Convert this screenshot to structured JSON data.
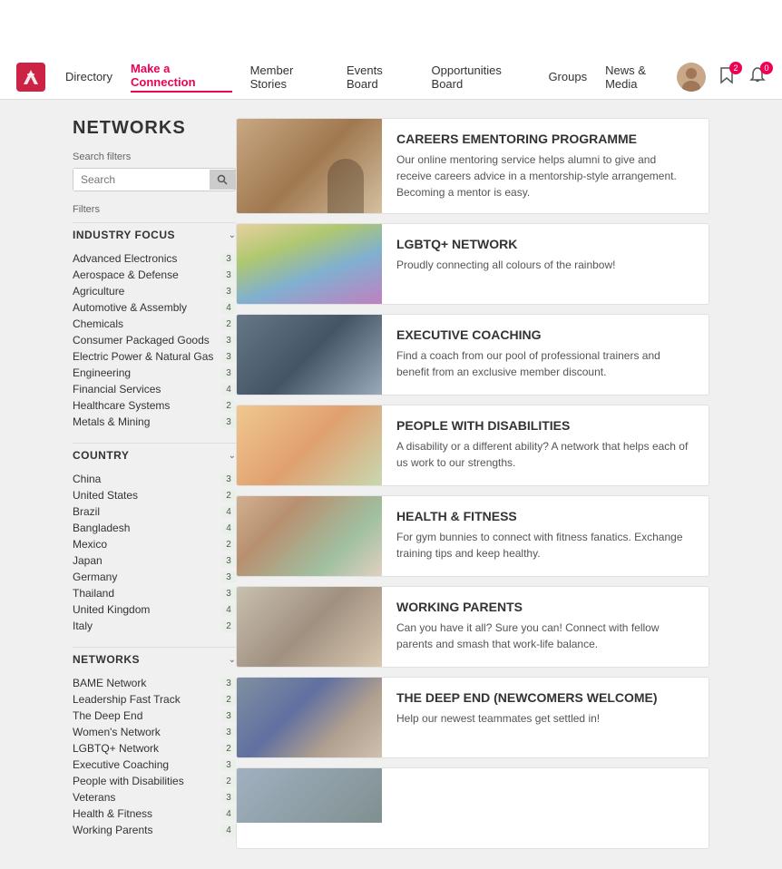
{
  "topbar": {},
  "nav": {
    "links": [
      {
        "label": "Directory",
        "active": false
      },
      {
        "label": "Make a Connection",
        "active": true
      },
      {
        "label": "Member Stories",
        "active": false
      },
      {
        "label": "Events Board",
        "active": false
      },
      {
        "label": "Opportunities Board",
        "active": false
      },
      {
        "label": "Groups",
        "active": false
      },
      {
        "label": "News & Media",
        "active": false
      }
    ],
    "badge_messages": "2",
    "badge_notifications": "0"
  },
  "page": {
    "title": "NETWORKS",
    "search_filters_label": "Search filters",
    "filters_label": "Filters",
    "search_placeholder": "Search"
  },
  "sidebar": {
    "industry_focus": {
      "label": "INDUSTRY FOCUS",
      "items": [
        {
          "label": "Advanced Electronics",
          "count": "3"
        },
        {
          "label": "Aerospace & Defense",
          "count": "3"
        },
        {
          "label": "Agriculture",
          "count": "3"
        },
        {
          "label": "Automotive & Assembly",
          "count": "4"
        },
        {
          "label": "Chemicals",
          "count": "2"
        },
        {
          "label": "Consumer Packaged Goods",
          "count": "3"
        },
        {
          "label": "Electric Power & Natural Gas",
          "count": "3"
        },
        {
          "label": "Engineering",
          "count": "3"
        },
        {
          "label": "Financial Services",
          "count": "4"
        },
        {
          "label": "Healthcare Systems",
          "count": "2"
        },
        {
          "label": "Metals & Mining",
          "count": "3"
        }
      ]
    },
    "country": {
      "label": "COUNTRY",
      "items": [
        {
          "label": "China",
          "count": "3"
        },
        {
          "label": "United States",
          "count": "2"
        },
        {
          "label": "Brazil",
          "count": "4"
        },
        {
          "label": "Bangladesh",
          "count": "4"
        },
        {
          "label": "Mexico",
          "count": "2"
        },
        {
          "label": "Japan",
          "count": "3"
        },
        {
          "label": "Germany",
          "count": "3"
        },
        {
          "label": "Thailand",
          "count": "3"
        },
        {
          "label": "United Kingdom",
          "count": "4"
        },
        {
          "label": "Italy",
          "count": "2"
        }
      ]
    },
    "networks": {
      "label": "NETWORKS",
      "items": [
        {
          "label": "BAME Network",
          "count": "3"
        },
        {
          "label": "Leadership Fast Track",
          "count": "2"
        },
        {
          "label": "The Deep End",
          "count": "3"
        },
        {
          "label": "Women's Network",
          "count": "3"
        },
        {
          "label": "LGBTQ+ Network",
          "count": "2"
        },
        {
          "label": "Executive Coaching",
          "count": "3"
        },
        {
          "label": "People with Disabilities",
          "count": "2"
        },
        {
          "label": "Veterans",
          "count": "3"
        },
        {
          "label": "Health & Fitness",
          "count": "4"
        },
        {
          "label": "Working Parents",
          "count": "4"
        }
      ]
    }
  },
  "cards": [
    {
      "title": "CAREERS EMENTORING PROGRAMME",
      "desc": "Our online mentoring service helps alumni to give and receive careers advice in a mentorship-style arrangement. Becoming a mentor is easy.",
      "img_class": "img-mentoring"
    },
    {
      "title": "LGBTQ+ NETWORK",
      "desc": "Proudly connecting all colours of the rainbow!",
      "img_class": "img-lgbtq"
    },
    {
      "title": "EXECUTIVE COACHING",
      "desc": "Find a coach from our pool of professional trainers and benefit from an exclusive member discount.",
      "img_class": "img-coaching"
    },
    {
      "title": "PEOPLE WITH DISABILITIES",
      "desc": "A disability or a different ability? A network that helps each of us work to our strengths.",
      "img_class": "img-disabilities"
    },
    {
      "title": "HEALTH & FITNESS",
      "desc": "For gym bunnies to connect with fitness fanatics. Exchange training tips and keep healthy.",
      "img_class": "img-fitness"
    },
    {
      "title": "WORKING PARENTS",
      "desc": "Can you have it all? Sure you can! Connect with fellow parents and smash that work-life balance.",
      "img_class": "img-parents"
    },
    {
      "title": "THE DEEP END (NEWCOMERS WELCOME)",
      "desc": "Help our newest teammates get settled in!",
      "img_class": "img-deepend"
    },
    {
      "title": "",
      "desc": "",
      "img_class": "img-last"
    }
  ]
}
